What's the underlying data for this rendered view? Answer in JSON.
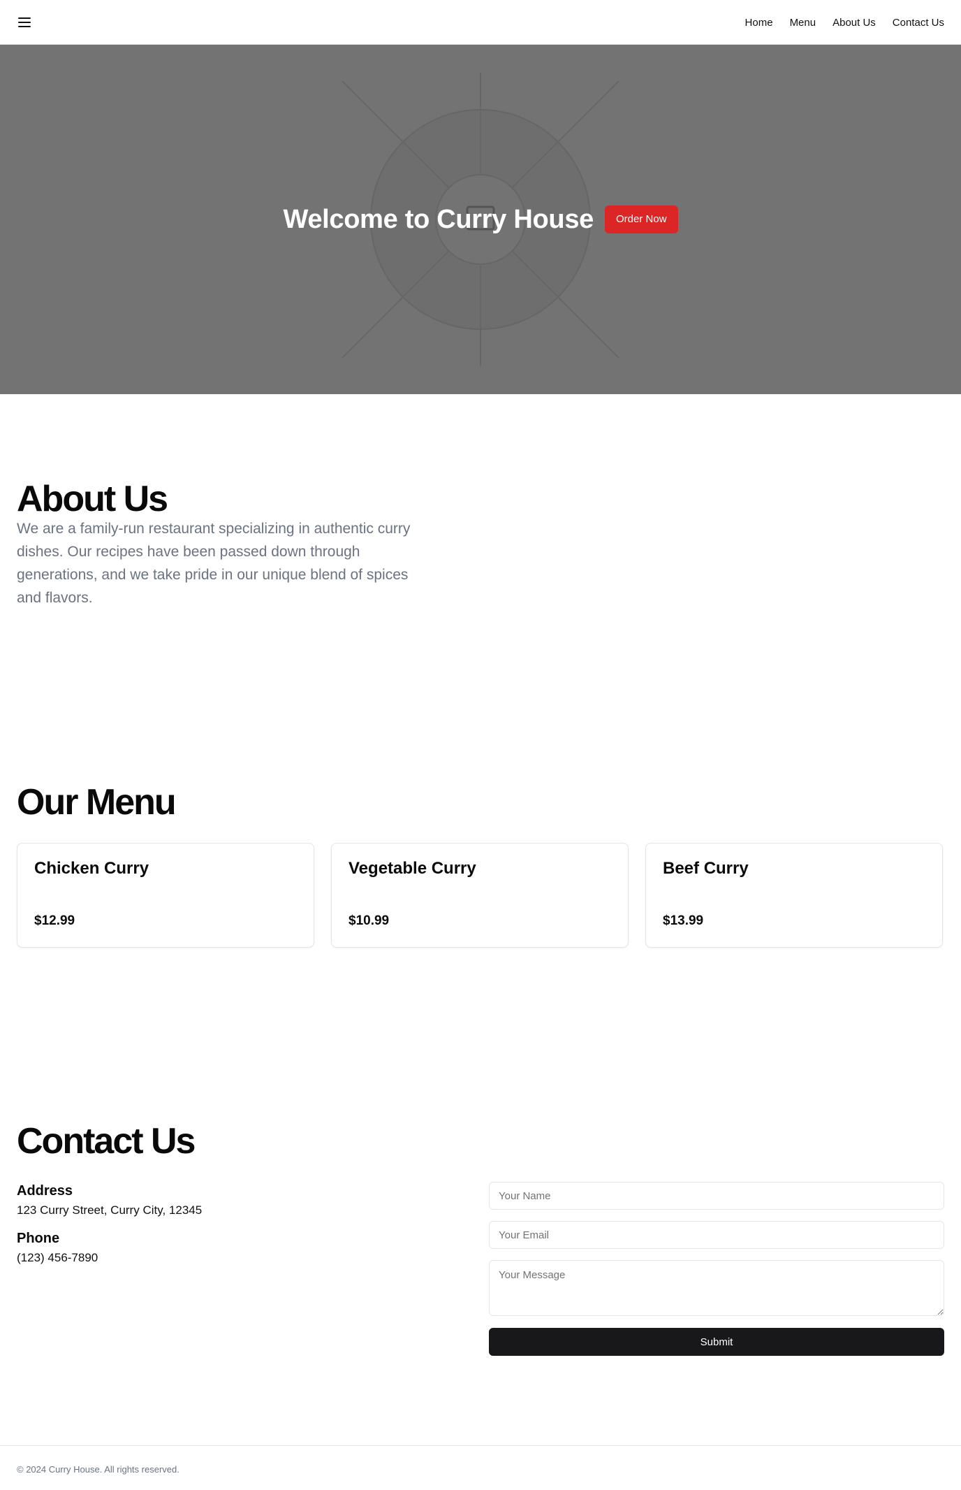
{
  "nav": {
    "menu_icon": "hamburger-menu-icon",
    "links": [
      "Home",
      "Menu",
      "About Us",
      "Contact Us"
    ]
  },
  "hero": {
    "title": "Welcome to Curry House",
    "cta": "Order Now",
    "background": "#737373",
    "accent": "#dc2626"
  },
  "about": {
    "title": "About Us",
    "text": "We are a family-run restaurant specializing in authentic curry dishes. Our recipes have been passed down through generations, and we take pride in our unique blend of spices and flavors."
  },
  "menu": {
    "title": "Our Menu",
    "items": [
      {
        "name": "Chicken Curry",
        "price": "$12.99"
      },
      {
        "name": "Vegetable Curry",
        "price": "$10.99"
      },
      {
        "name": "Beef Curry",
        "price": "$13.99"
      }
    ]
  },
  "contact": {
    "title": "Contact Us",
    "address_label": "Address",
    "address": "123 Curry Street, Curry City, 12345",
    "phone_label": "Phone",
    "phone": "(123) 456-7890",
    "form": {
      "name_placeholder": "Your Name",
      "email_placeholder": "Your Email",
      "message_placeholder": "Your Message",
      "submit": "Submit"
    }
  },
  "footer": {
    "text": "© 2024 Curry House. All rights reserved."
  }
}
